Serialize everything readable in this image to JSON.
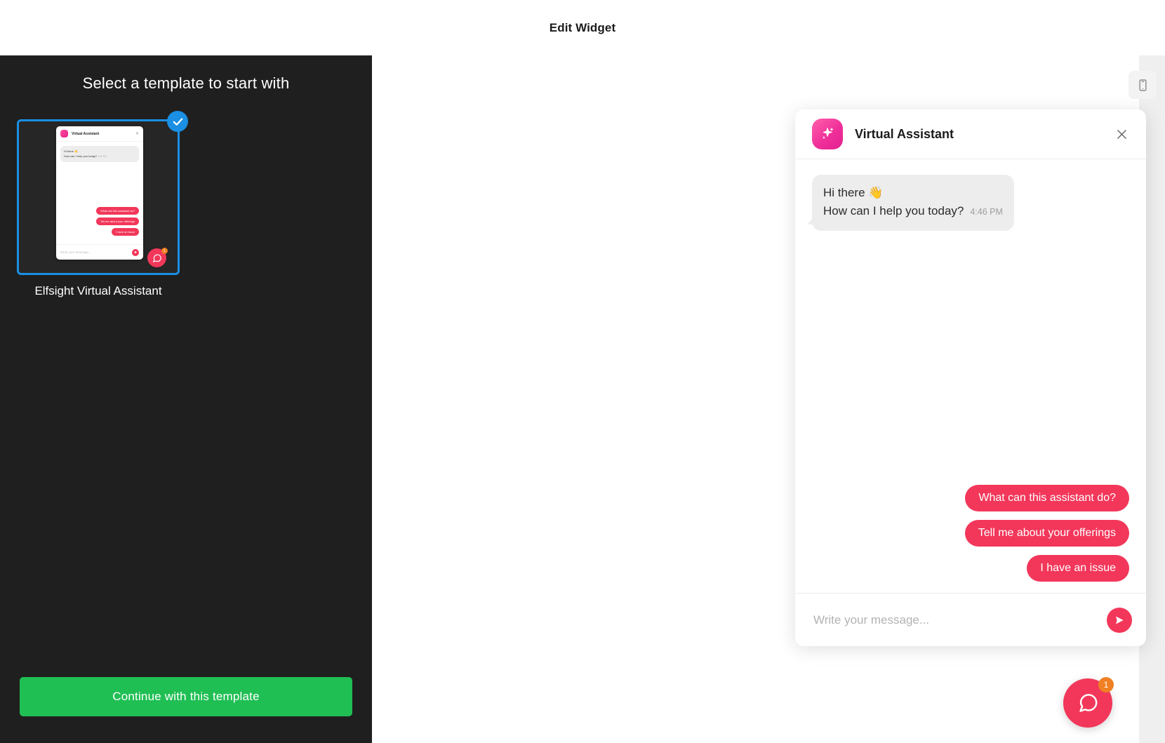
{
  "topbar": {
    "title": "Edit Widget"
  },
  "sidebar": {
    "heading": "Select a template to start with",
    "templates": [
      {
        "label": "Elfsight Virtual Assistant",
        "selected": true
      }
    ],
    "continue_label": "Continue with this template"
  },
  "preview": {
    "device_toggle_icon": "mobile-phone-icon"
  },
  "widget": {
    "header": {
      "title": "Virtual Assistant",
      "avatar_icon": "sparkle-icon",
      "close_icon": "close-icon"
    },
    "messages": [
      {
        "sender": "bot",
        "line1": "Hi there 👋",
        "line2": "How can I help you today?",
        "time": "4:46 PM"
      }
    ],
    "quick_replies": [
      "What can this assistant do?",
      "Tell me about your offerings",
      "I have an issue"
    ],
    "composer": {
      "placeholder": "Write your message...",
      "value": "",
      "send_icon": "send-arrow-icon"
    }
  },
  "launcher": {
    "icon": "chat-bubble-icon",
    "badge_count": "1"
  },
  "thumbnail": {
    "title": "Virtual Assistant",
    "line1": "Hi there 👋",
    "line2": "How can I help you today?",
    "time": "4:46 PM",
    "replies": [
      "What can this assistant do?",
      "Tell me about your offerings",
      "I have an issue"
    ],
    "placeholder": "Write your message...",
    "badge_count": "1"
  },
  "colors": {
    "accent_pink": "#f2375a",
    "accent_green": "#1fbf53",
    "accent_blue": "#1a8fe3",
    "badge_orange": "#f08023",
    "sidebar_bg": "#1f1f1f"
  }
}
